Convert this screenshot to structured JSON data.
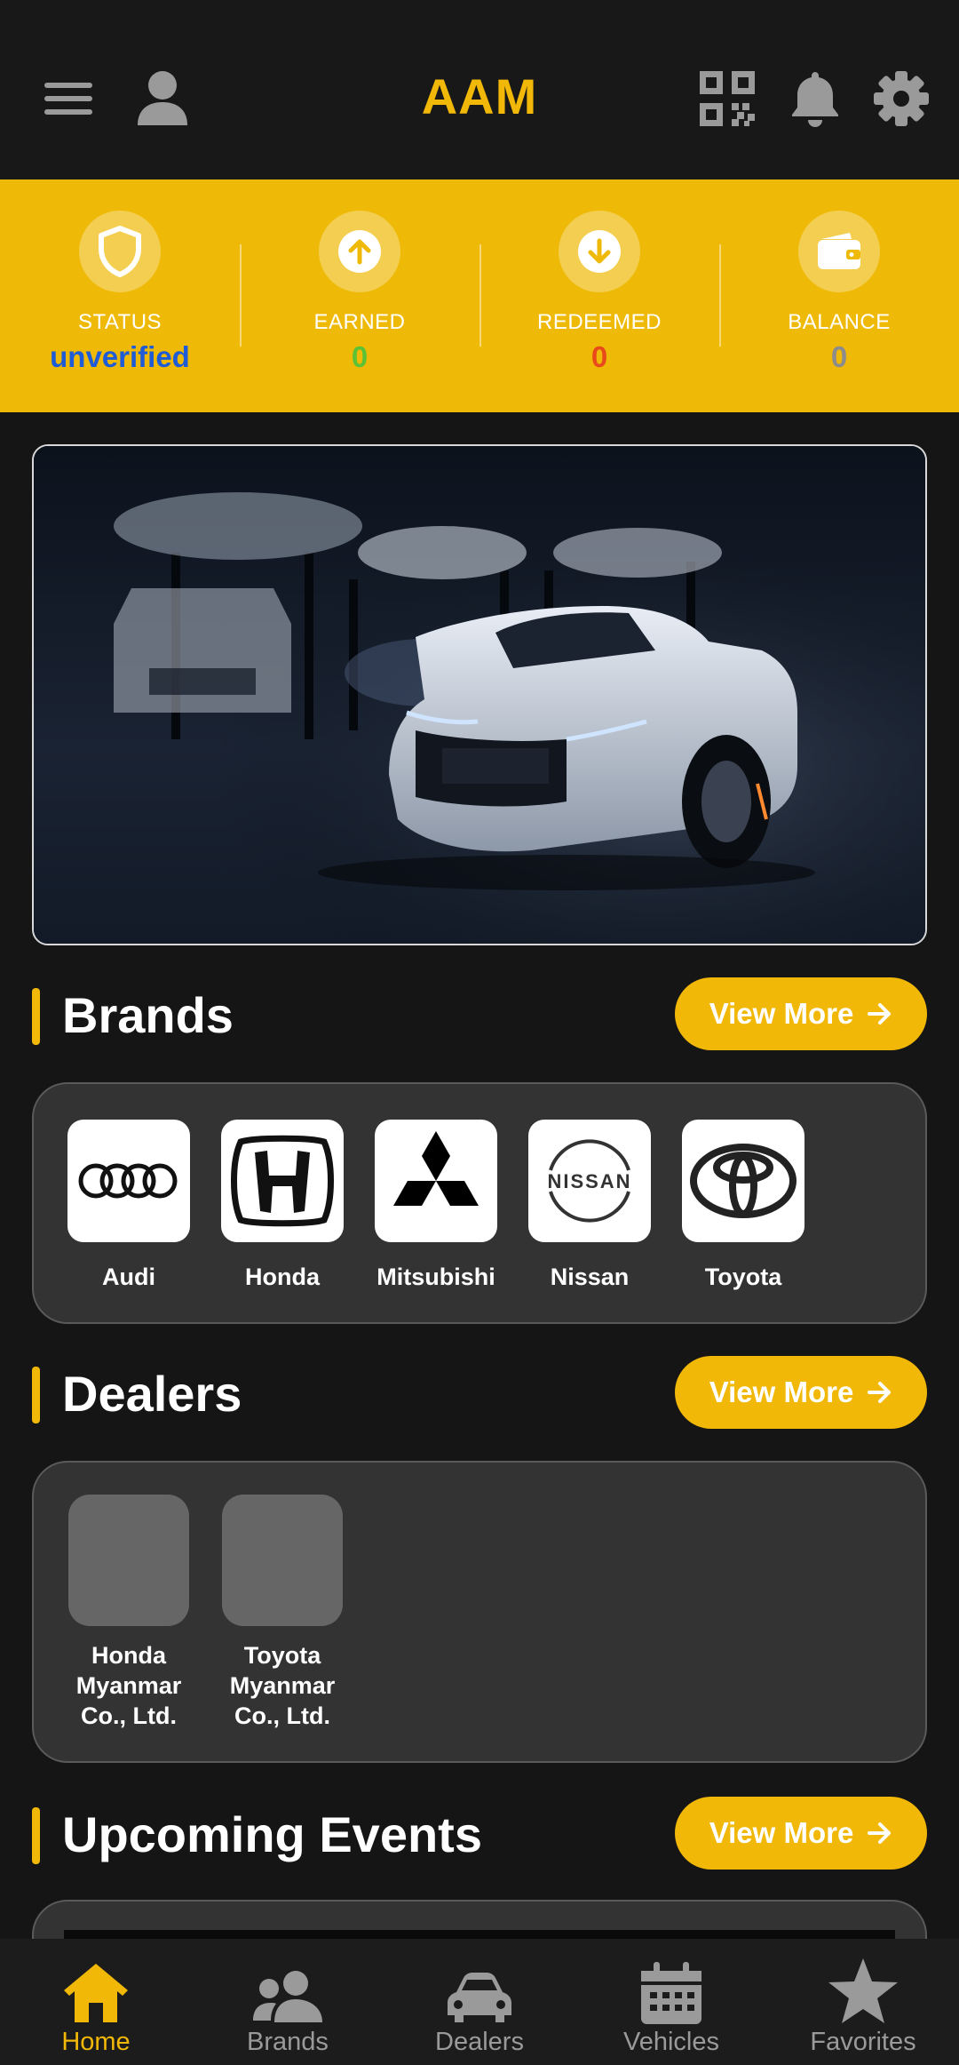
{
  "app": {
    "title": "AAM"
  },
  "header_icons": [
    "menu-icon",
    "profile-icon",
    "qr-code-icon",
    "bell-icon",
    "settings-icon"
  ],
  "stats": [
    {
      "icon": "shield-icon",
      "label": "STATUS",
      "value": "unverified",
      "color": "#1E5BD6"
    },
    {
      "icon": "arrow-up-circle-icon",
      "label": "EARNED",
      "value": "0",
      "color": "#5BC236"
    },
    {
      "icon": "arrow-down-circle-icon",
      "label": "REDEEMED",
      "value": "0",
      "color": "#E94A1B"
    },
    {
      "icon": "wallet-icon",
      "label": "BALANCE",
      "value": "0",
      "color": "#8C8C8C"
    }
  ],
  "sections": {
    "brands": {
      "title": "Brands",
      "view_more": "View More",
      "items": [
        {
          "name": "Audi",
          "logo": "audi-logo"
        },
        {
          "name": "Honda",
          "logo": "honda-logo"
        },
        {
          "name": "Mitsubishi",
          "logo": "mitsubishi-logo"
        },
        {
          "name": "Nissan",
          "logo": "nissan-logo",
          "logo_text": "NISSAN"
        },
        {
          "name": "Toyota",
          "logo": "toyota-logo"
        }
      ]
    },
    "dealers": {
      "title": "Dealers",
      "view_more": "View More",
      "items": [
        {
          "name_lines": [
            "Honda",
            "Myanmar",
            "Co., Ltd."
          ]
        },
        {
          "name_lines": [
            "Toyota",
            "Myanmar",
            "Co., Ltd."
          ]
        }
      ]
    },
    "events": {
      "title": "Upcoming Events",
      "view_more": "View More"
    }
  },
  "nav": [
    {
      "label": "Home",
      "icon": "home-icon",
      "active": true
    },
    {
      "label": "Brands",
      "icon": "users-icon",
      "active": false
    },
    {
      "label": "Dealers",
      "icon": "car-icon",
      "active": false
    },
    {
      "label": "Vehicles",
      "icon": "calendar-icon",
      "active": false
    },
    {
      "label": "Favorites",
      "icon": "star-icon",
      "active": false
    }
  ],
  "colors": {
    "accent": "#F2B807",
    "background": "#151515",
    "card": "#333333",
    "nav_inactive": "#9a9a9a"
  }
}
